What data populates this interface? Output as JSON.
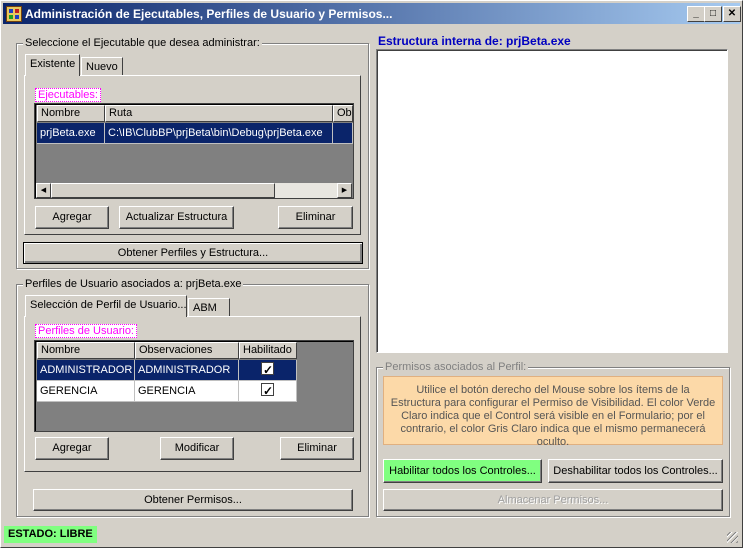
{
  "window": {
    "title": "Administración de Ejecutables, Perfiles de Usuario y Permisos...",
    "minimize": "_",
    "maximize": "□",
    "close": "✕"
  },
  "executables": {
    "group_title": "Seleccione el Ejecutable que desea administrar:",
    "tabs": [
      "Existente",
      "Nuevo"
    ],
    "list_label": "Ejecutables:",
    "columns": [
      "Nombre",
      "Ruta",
      "Ob"
    ],
    "rows": [
      {
        "nombre": "prjBeta.exe",
        "ruta": "C:\\IB\\ClubBP\\prjBeta\\bin\\Debug\\prjBeta.exe"
      }
    ],
    "buttons": {
      "add": "Agregar",
      "update": "Actualizar Estructura",
      "delete": "Eliminar"
    },
    "get_button": "Obtener Perfiles y Estructura..."
  },
  "profiles": {
    "group_title": "Perfiles de Usuario asociados a: prjBeta.exe",
    "tabs": [
      "Selección de Perfil de Usuario...",
      "ABM"
    ],
    "list_label": "Perfiles de Usuario:",
    "columns": [
      "Nombre",
      "Observaciones",
      "Habilitado"
    ],
    "rows": [
      {
        "nombre": "ADMINISTRADOR",
        "obs": "ADMINISTRADOR",
        "habilitado": true
      },
      {
        "nombre": "GERENCIA",
        "obs": "GERENCIA",
        "habilitado": true
      }
    ],
    "buttons": {
      "add": "Agregar",
      "modify": "Modificar",
      "delete": "Eliminar"
    },
    "get_button": "Obtener Permisos..."
  },
  "structure": {
    "title": "Estructura interna de: prjBeta.exe"
  },
  "permissions": {
    "group_title": "Permisos asociados al Perfil:",
    "info": "Utilice el botón derecho del Mouse sobre los ítems de la Estructura para configurar el Permiso de Visibilidad. El color Verde Claro indica que el Control será visible en el Formulario; por el contrario, el color Gris Claro indica que el mismo permanecerá oculto.",
    "enable_all": "Habilitar todos los Controles...",
    "disable_all": "Deshabilitar todos los Controles...",
    "save": "Almacenar Permisos..."
  },
  "status": {
    "text": "ESTADO: LIBRE"
  },
  "colors": {
    "title_start": "#0a246a",
    "title_end": "#a6caf0",
    "selection": "#0a246a",
    "label_magenta": "#ff00ff",
    "info_bg": "#fcd9a8",
    "enable_btn": "#80ff80",
    "status_bg": "#80ff80",
    "structure_title": "#0000c0"
  }
}
